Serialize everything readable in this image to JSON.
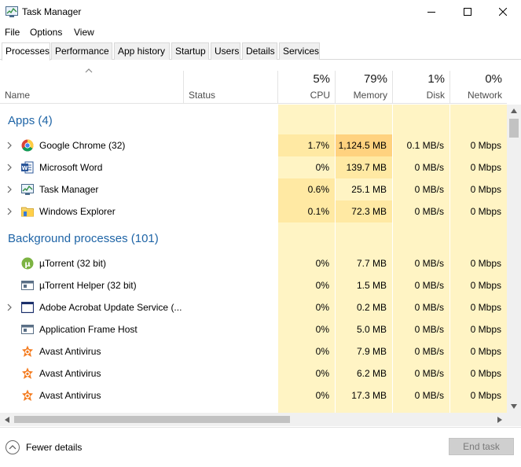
{
  "window": {
    "title": "Task Manager"
  },
  "menu": [
    "File",
    "Options",
    "View"
  ],
  "tabs": [
    "Processes",
    "Performance",
    "App history",
    "Startup",
    "Users",
    "Details",
    "Services"
  ],
  "active_tab": "Processes",
  "header": {
    "name": "Name",
    "status": "Status",
    "cpu": {
      "percent": "5%",
      "label": "CPU"
    },
    "memory": {
      "percent": "79%",
      "label": "Memory"
    },
    "disk": {
      "percent": "1%",
      "label": "Disk"
    },
    "network": {
      "percent": "0%",
      "label": "Network"
    }
  },
  "groups": {
    "apps": "Apps (4)",
    "background": "Background processes (101)"
  },
  "apps": [
    {
      "name": "Google Chrome (32)",
      "icon": "chrome-icon",
      "cpu": "1.7%",
      "memory": "1,124.5 MB",
      "disk": "0.1 MB/s",
      "network": "0 Mbps"
    },
    {
      "name": "Microsoft Word",
      "icon": "word-icon",
      "cpu": "0%",
      "memory": "139.7 MB",
      "disk": "0 MB/s",
      "network": "0 Mbps"
    },
    {
      "name": "Task Manager",
      "icon": "task-manager-icon",
      "cpu": "0.6%",
      "memory": "25.1 MB",
      "disk": "0 MB/s",
      "network": "0 Mbps"
    },
    {
      "name": "Windows Explorer",
      "icon": "folder-icon",
      "cpu": "0.1%",
      "memory": "72.3 MB",
      "disk": "0 MB/s",
      "network": "0 Mbps"
    }
  ],
  "background": [
    {
      "name": "µTorrent (32 bit)",
      "icon": "utorrent-icon",
      "cpu": "0%",
      "memory": "7.7 MB",
      "disk": "0 MB/s",
      "network": "0 Mbps"
    },
    {
      "name": "µTorrent Helper (32 bit)",
      "icon": "utorrent-helper-icon",
      "cpu": "0%",
      "memory": "1.5 MB",
      "disk": "0 MB/s",
      "network": "0 Mbps"
    },
    {
      "name": "Adobe Acrobat Update Service (...",
      "icon": "service-window-icon",
      "cpu": "0%",
      "memory": "0.2 MB",
      "disk": "0 MB/s",
      "network": "0 Mbps"
    },
    {
      "name": "Application Frame Host",
      "icon": "app-window-icon",
      "cpu": "0%",
      "memory": "5.0 MB",
      "disk": "0 MB/s",
      "network": "0 Mbps"
    },
    {
      "name": "Avast Antivirus",
      "icon": "avast-icon",
      "cpu": "0%",
      "memory": "7.9 MB",
      "disk": "0 MB/s",
      "network": "0 Mbps"
    },
    {
      "name": "Avast Antivirus",
      "icon": "avast-icon",
      "cpu": "0%",
      "memory": "6.2 MB",
      "disk": "0 MB/s",
      "network": "0 Mbps"
    },
    {
      "name": "Avast Antivirus",
      "icon": "avast-icon",
      "cpu": "0%",
      "memory": "17.3 MB",
      "disk": "0 MB/s",
      "network": "0 Mbps"
    }
  ],
  "footer": {
    "fewer_details": "Fewer details",
    "end_task": "End task"
  },
  "colors": {
    "group_heading": "#1e64a6",
    "heat_low": "#fff4c4",
    "heat_mid": "#ffe9a3",
    "heat_high": "#ffd27f"
  }
}
